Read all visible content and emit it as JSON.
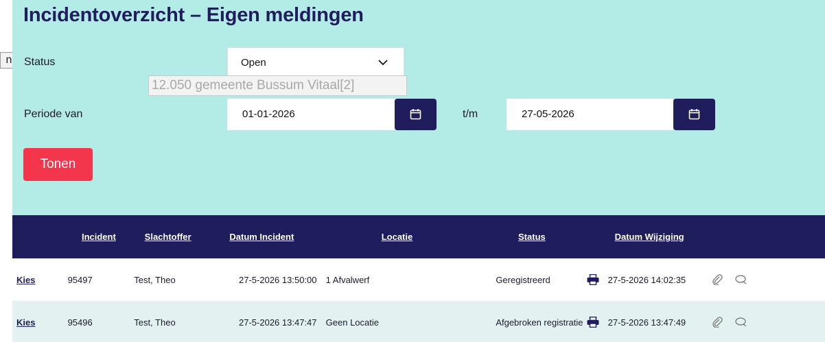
{
  "page": {
    "title": "Incidentoverzicht – Eigen meldingen",
    "side_tab": "n"
  },
  "filters": {
    "status_label": "Status",
    "status_value": "Open",
    "tooltip": "12.050 gemeente Bussum Vitaal[2]",
    "period_label": "Periode van",
    "date_from": "01-01-2026",
    "date_to_label": "t/m",
    "date_to": "27-05-2026",
    "submit_label": "Tonen"
  },
  "table": {
    "headers": [
      "Incident",
      "Slachtoffer",
      "Datum Incident",
      "Locatie",
      "Status",
      "Datum Wijziging"
    ],
    "rows": [
      {
        "action": "Kies",
        "incident": "95497",
        "victim": "Test, Theo",
        "date": "27-5-2026 13:50:00",
        "location": "1 Afvalwerf",
        "status": "Geregistreerd",
        "modified": "27-5-2026 14:02:35"
      },
      {
        "action": "Kies",
        "incident": "95496",
        "victim": "Test, Theo",
        "date": "27-5-2026 13:47:47",
        "location": "Geen Locatie",
        "status": "Afgebroken registratie",
        "modified": "27-5-2026 13:47:49"
      }
    ]
  },
  "colors": {
    "navy": "#1f1d5c",
    "teal_bg": "#b3ebe6",
    "button_red": "#f4364c"
  },
  "icons": [
    "chevron-down-icon",
    "calendar-icon",
    "printer-icon",
    "paperclip-icon",
    "comment-icon"
  ]
}
